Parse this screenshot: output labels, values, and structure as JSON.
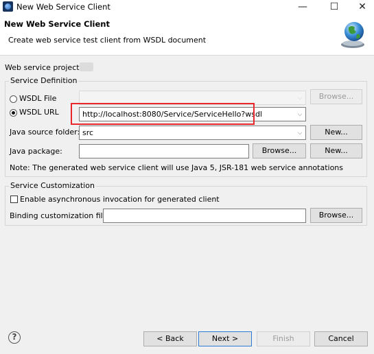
{
  "window": {
    "title": "New Web Service Client",
    "minimize_glyph": "—",
    "maximize_glyph": "☐",
    "close_glyph": "✕"
  },
  "header": {
    "title": "New Web Service Client",
    "description": "Create web service test client from WSDL document"
  },
  "project": {
    "label": "Web service project:"
  },
  "service_definition": {
    "legend": "Service Definition",
    "wsdl_file_label": "WSDL File",
    "wsdl_file_value": "",
    "wsdl_url_label": "WSDL URL",
    "wsdl_url_value": "http://localhost:8080/Service/ServiceHello?wsdl",
    "selected_option": "WSDL URL",
    "browse_label": "Browse...",
    "java_source_folder_label": "Java source folder:",
    "java_source_folder_value": "src",
    "new_label": "New...",
    "java_package_label": "Java package:",
    "java_package_value": "",
    "note": "Note: The generated web service client will use Java 5, JSR-181 web service annotations"
  },
  "service_customization": {
    "legend": "Service Customization",
    "async_label": "Enable asynchronous invocation for generated client",
    "async_checked": false,
    "binding_label": "Binding customization file:",
    "binding_value": "",
    "browse_label": "Browse..."
  },
  "footer": {
    "help_glyph": "?",
    "back_label": "< Back",
    "next_label": "Next >",
    "finish_label": "Finish",
    "cancel_label": "Cancel"
  },
  "colors": {
    "highlight": "#e8262c",
    "default_button_border": "#2b7ad6"
  },
  "icons": {
    "app": "eclipse-app-icon",
    "banner": "globe-wizard-icon",
    "help": "help-icon"
  }
}
